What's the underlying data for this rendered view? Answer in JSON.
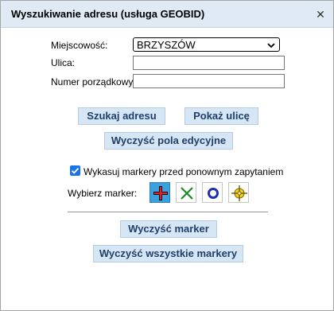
{
  "dialog": {
    "title": "Wyszukiwanie adresu (usługa GEOBID)",
    "close_symbol": "✕"
  },
  "form": {
    "locality_label": "Miejscowość:",
    "locality_value": "BRZYSZÓW",
    "street_label": "Ulica:",
    "street_value": "",
    "number_label": "Numer porządkowy:",
    "number_value": ""
  },
  "buttons": {
    "search_address": "Szukaj adresu",
    "show_street": "Pokaż ulicę",
    "clear_fields": "Wyczyść pola edycyjne",
    "clear_marker": "Wyczyść marker",
    "clear_all_markers": "Wyczyść wszystkie markery"
  },
  "options": {
    "delete_markers_label": "Wykasuj markery przed ponownym zapytaniem",
    "delete_markers_checked": true,
    "choose_marker_label": "Wybierz marker:"
  },
  "markers": [
    {
      "name": "red-cross-marker",
      "selected": true
    },
    {
      "name": "green-x-marker",
      "selected": false
    },
    {
      "name": "blue-circle-marker",
      "selected": false
    },
    {
      "name": "yellow-crosshair-marker",
      "selected": false
    }
  ],
  "colors": {
    "titlebar_bg": "#dfeaf5",
    "button_bg": "#d7e6f5",
    "button_text": "#1f3f6b",
    "selected_marker_bg": "#3aa0de",
    "checkbox": "#1a73e8"
  }
}
